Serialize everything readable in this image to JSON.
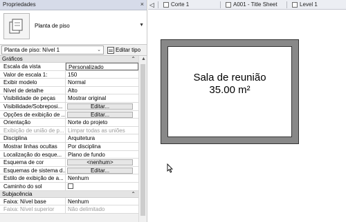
{
  "palette": {
    "title": "Propriedades",
    "close": "×",
    "type_name": "Planta de piso",
    "filter_value": "Planta de piso: Nível 1",
    "edit_type_label": "Editar tipo"
  },
  "sections": {
    "graphics": "Gráficos",
    "underlay": "Subjacência"
  },
  "graphics_rows": [
    {
      "k": "Escala da vista",
      "v": "Personalizado",
      "kind": "input"
    },
    {
      "k": "Valor de escala    1:",
      "v": "150",
      "kind": "text"
    },
    {
      "k": "Exibir modelo",
      "v": "Normal",
      "kind": "text"
    },
    {
      "k": "Nível de detalhe",
      "v": "Alto",
      "kind": "text"
    },
    {
      "k": "Visibilidade de peças",
      "v": "Mostrar original",
      "kind": "text"
    },
    {
      "k": "Visibilidade/Sobreposi...",
      "v": "Editar...",
      "kind": "button"
    },
    {
      "k": "Opções de exibição de ...",
      "v": "Editar...",
      "kind": "button"
    },
    {
      "k": "Orientação",
      "v": "Norte do projeto",
      "kind": "text"
    },
    {
      "k": "Exibição de união de p...",
      "v": "Limpar todas as uniões",
      "kind": "dim"
    },
    {
      "k": "Disciplina",
      "v": "Arquitetura",
      "kind": "text"
    },
    {
      "k": "Mostrar linhas ocultas",
      "v": "Por disciplina",
      "kind": "text"
    },
    {
      "k": "Localização do esque...",
      "v": "Plano de fundo",
      "kind": "text"
    },
    {
      "k": "Esquema de cor",
      "v": "<nenhum>",
      "kind": "button"
    },
    {
      "k": "Esquemas de sistema d...",
      "v": "Editar...",
      "kind": "button"
    },
    {
      "k": "Estilo de exibição de a...",
      "v": "Nenhum",
      "kind": "text"
    },
    {
      "k": "Caminho do sol",
      "v": "",
      "kind": "checkbox"
    }
  ],
  "underlay_rows": [
    {
      "k": "Faixa: Nível base",
      "v": "Nenhum",
      "kind": "text"
    },
    {
      "k": "Faixa: Nível superior",
      "v": "Não delimitado",
      "kind": "dim"
    }
  ],
  "tabs": [
    "Corte 1",
    "A001 - Title Sheet",
    "Level 1"
  ],
  "room": {
    "name": "Sala de reunião",
    "area": "35.00 m²"
  },
  "colors": {
    "wall": "#888888",
    "title_bar": "#d6dbe9"
  }
}
